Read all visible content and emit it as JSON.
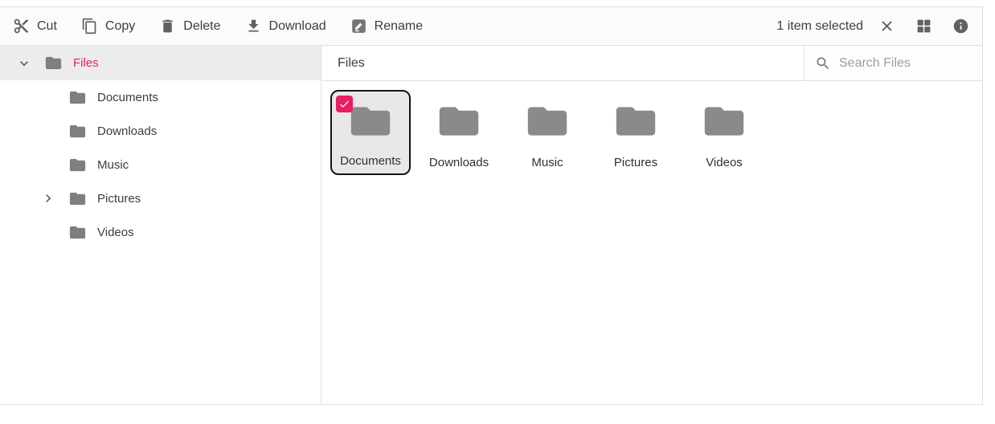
{
  "toolbar": {
    "actions": [
      {
        "label": "Cut",
        "icon": "scissors-icon"
      },
      {
        "label": "Copy",
        "icon": "copy-icon"
      },
      {
        "label": "Delete",
        "icon": "trash-icon"
      },
      {
        "label": "Download",
        "icon": "download-icon"
      },
      {
        "label": "Rename",
        "icon": "rename-icon"
      }
    ],
    "selection_status": "1 item selected",
    "right_icons": [
      "close-icon",
      "grid-view-icon",
      "info-icon"
    ]
  },
  "sidebar": {
    "root_label": "Files",
    "root_expanded": true,
    "items": [
      {
        "label": "Documents",
        "expandable": false
      },
      {
        "label": "Downloads",
        "expandable": false
      },
      {
        "label": "Music",
        "expandable": false
      },
      {
        "label": "Pictures",
        "expandable": true
      },
      {
        "label": "Videos",
        "expandable": false
      }
    ]
  },
  "main": {
    "breadcrumb": "Files",
    "search_placeholder": "Search Files",
    "search_value": "",
    "tiles": [
      {
        "label": "Documents",
        "selected": true
      },
      {
        "label": "Downloads",
        "selected": false
      },
      {
        "label": "Music",
        "selected": false
      },
      {
        "label": "Pictures",
        "selected": false
      },
      {
        "label": "Videos",
        "selected": false
      }
    ]
  },
  "colors": {
    "accent": "#e91e63",
    "folder_gray": "#8a8a8a",
    "divider": "#e0e0e0",
    "selected_tile_bg": "#e8e8e8",
    "selected_row_bg": "#ececec"
  }
}
